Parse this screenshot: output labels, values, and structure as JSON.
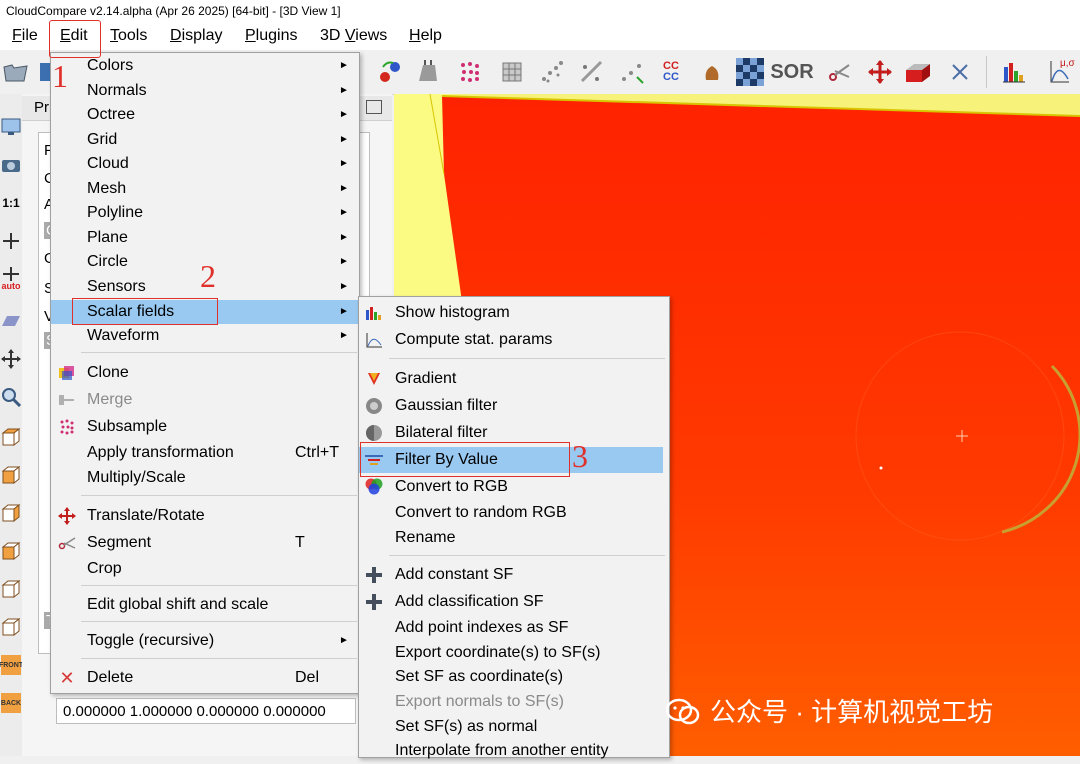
{
  "window": {
    "title": "CloudCompare v2.14.alpha (Apr 26 2025) [64-bit] - [3D View 1]"
  },
  "menubar": {
    "items": [
      {
        "pre": "",
        "u": "F",
        "post": "ile"
      },
      {
        "pre": "",
        "u": "E",
        "post": "dit"
      },
      {
        "pre": "",
        "u": "T",
        "post": "ools"
      },
      {
        "pre": "",
        "u": "D",
        "post": "isplay"
      },
      {
        "pre": "",
        "u": "P",
        "post": "lugins"
      },
      {
        "pre": "3D ",
        "u": "V",
        "post": "iews"
      },
      {
        "pre": "",
        "u": "H",
        "post": "elp"
      }
    ]
  },
  "toolbar": {
    "sor_label": "SOR",
    "cc_label": "CC",
    "stat_label": "μ,σ"
  },
  "lefttoolbar": {
    "scale_label": "1:1",
    "auto_label": "auto",
    "front_label": "FRONT",
    "back_label": "BACK"
  },
  "properties": {
    "header": "Pr",
    "letters": [
      "F",
      "C",
      "A",
      "C",
      "G",
      "S",
      "V",
      "S"
    ],
    "side_label": "T",
    "matrix_row": "0.000000 1.000000 0.000000 0.000000"
  },
  "edit_menu": {
    "items": [
      {
        "label": "Colors",
        "submenu": true
      },
      {
        "label": "Normals",
        "submenu": true
      },
      {
        "label": "Octree",
        "submenu": true
      },
      {
        "label": "Grid",
        "submenu": true
      },
      {
        "label": "Cloud",
        "submenu": true
      },
      {
        "label": "Mesh",
        "submenu": true
      },
      {
        "label": "Polyline",
        "submenu": true
      },
      {
        "label": "Plane",
        "submenu": true
      },
      {
        "label": "Circle",
        "submenu": true
      },
      {
        "label": "Sensors",
        "submenu": true
      },
      {
        "label": "Scalar fields",
        "submenu": true,
        "highlighted": true
      },
      {
        "label": "Waveform",
        "submenu": true
      },
      {
        "label": "Clone",
        "icon": "clone-icon"
      },
      {
        "label": "Merge",
        "icon": "merge-icon",
        "disabled": true
      },
      {
        "label": "Subsample",
        "icon": "subsample-icon"
      },
      {
        "label": "Apply transformation",
        "shortcut": "Ctrl+T"
      },
      {
        "label": "Multiply/Scale"
      },
      {
        "label": "Translate/Rotate",
        "icon": "translate-rotate-icon"
      },
      {
        "label": "Segment",
        "icon": "scissors-icon",
        "shortcut": "T"
      },
      {
        "label": "Crop"
      },
      {
        "label": "Edit global shift and scale"
      },
      {
        "label": "Toggle (recursive)",
        "submenu": true
      },
      {
        "label": "Delete",
        "icon": "delete-icon",
        "shortcut": "Del"
      }
    ]
  },
  "scalar_fields_menu": {
    "items": [
      {
        "label": "Show histogram",
        "icon": "histogram-icon"
      },
      {
        "label": "Compute stat. params",
        "icon": "stat-params-icon"
      },
      {
        "label": "Gradient",
        "icon": "gradient-icon"
      },
      {
        "label": "Gaussian filter",
        "icon": "gaussian-filter-icon"
      },
      {
        "label": "Bilateral filter",
        "icon": "bilateral-filter-icon"
      },
      {
        "label": "Filter By Value",
        "icon": "filter-by-value-icon",
        "highlighted": true
      },
      {
        "label": "Convert to RGB",
        "icon": "rgb-icon"
      },
      {
        "label": "Convert to random RGB"
      },
      {
        "label": "Rename"
      },
      {
        "label": "Add constant SF",
        "icon": "plus-icon"
      },
      {
        "label": "Add classification SF",
        "icon": "plus-icon"
      },
      {
        "label": "Add point indexes as SF"
      },
      {
        "label": "Export coordinate(s) to SF(s)"
      },
      {
        "label": "Set SF as coordinate(s)"
      },
      {
        "label": "Export normals to SF(s)",
        "disabled": true
      },
      {
        "label": "Set SF(s) as normal"
      },
      {
        "label": "Interpolate from another entity"
      }
    ]
  },
  "annotations": {
    "step1": "1",
    "step2": "2",
    "step3": "3"
  },
  "watermark": {
    "text": "公众号 · 计算机视觉工坊"
  },
  "colors": {
    "highlight": "#99c9f0",
    "annotation_red": "#e0302a",
    "cloud_red": "#ff2a00",
    "cloud_orange": "#ff5a00",
    "background_yellow": "#fbfb84"
  }
}
